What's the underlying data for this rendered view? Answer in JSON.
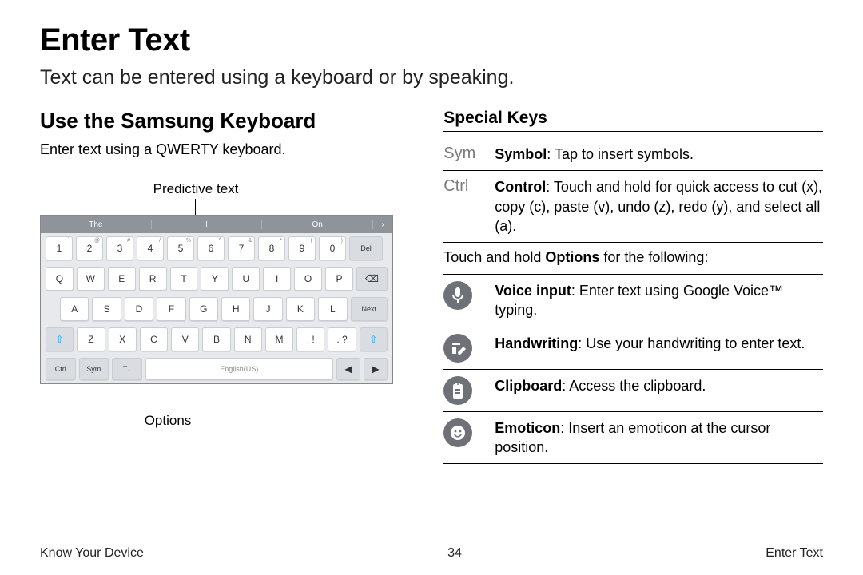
{
  "title": "Enter Text",
  "intro": "Text can be entered using a keyboard or by speaking.",
  "left": {
    "heading": "Use the Samsung Keyboard",
    "body": "Enter text using a QWERTY keyboard.",
    "label_predictive": "Predictive text",
    "label_options": "Options"
  },
  "kb": {
    "pred": [
      "The",
      "I",
      "On",
      "›"
    ],
    "row1": [
      {
        "k": "1",
        "s": "`"
      },
      {
        "k": "2",
        "s": "@"
      },
      {
        "k": "3",
        "s": "#"
      },
      {
        "k": "4",
        "s": "/"
      },
      {
        "k": "5",
        "s": "%"
      },
      {
        "k": "6",
        "s": "^"
      },
      {
        "k": "7",
        "s": "&"
      },
      {
        "k": "8",
        "s": "*"
      },
      {
        "k": "9",
        "s": "("
      },
      {
        "k": "0",
        "s": ")"
      }
    ],
    "del": "Del",
    "row2": [
      "Q",
      "W",
      "E",
      "R",
      "T",
      "Y",
      "U",
      "I",
      "O",
      "P"
    ],
    "bksp": "⌫",
    "row3": [
      "A",
      "S",
      "D",
      "F",
      "G",
      "H",
      "J",
      "K",
      "L"
    ],
    "next": "Next",
    "shift": "⇧",
    "row4": [
      "Z",
      "X",
      "C",
      "V",
      "B",
      "N",
      "M"
    ],
    "comma": ", !",
    "period": ". ?",
    "ctrl": "Ctrl",
    "sym": "Sym",
    "opt": "T↓",
    "space": "English(US)",
    "left": "◀",
    "right": "▶"
  },
  "right": {
    "heading": "Special Keys",
    "sym_key": "Sym",
    "sym_label": "Symbol",
    "sym_desc": ": Tap to insert symbols.",
    "ctrl_key": "Ctrl",
    "ctrl_label": "Control",
    "ctrl_desc": ": Touch and hold for quick access to cut (x), copy (c), paste (v), undo (z), redo (y), and select all (a).",
    "touch_pre": "Touch and hold ",
    "touch_bold": "Options",
    "touch_post": " for the following:",
    "voice_label": "Voice input",
    "voice_desc": ": Enter text using Google Voice™ typing.",
    "hand_label": "Handwriting",
    "hand_desc": ": Use your handwriting to enter text.",
    "clip_label": "Clipboard",
    "clip_desc": ": Access the clipboard.",
    "emot_label": "Emoticon",
    "emot_desc": ": Insert an emoticon at the cursor position."
  },
  "footer": {
    "left": "Know Your Device",
    "center": "34",
    "right": "Enter Text"
  }
}
